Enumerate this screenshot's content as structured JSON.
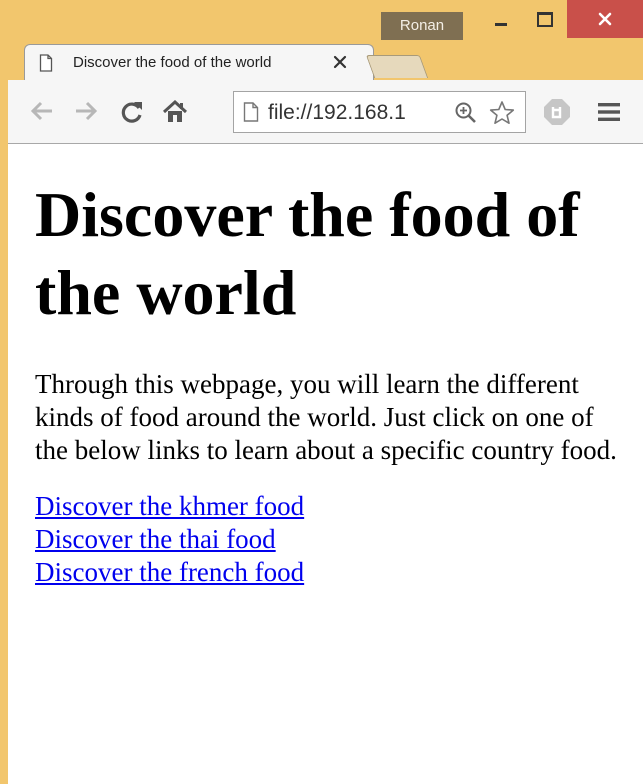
{
  "window": {
    "user_name": "Ronan",
    "close_color": "#c9504a",
    "frame_color": "#f2c66d"
  },
  "tab": {
    "title": "Discover the food of the world",
    "icon": "document-icon"
  },
  "toolbar": {
    "icons": [
      "back-arrow-icon",
      "forward-arrow-icon",
      "reload-icon",
      "home-icon",
      "zoom-icon",
      "star-icon",
      "adblock-icon",
      "menu-icon"
    ]
  },
  "address_bar": {
    "url": "file://192.168.1"
  },
  "page": {
    "heading": "Discover the food of the world",
    "intro": "Through this webpage, you will learn the different kinds of food around the world. Just click on one of the below links to learn about a specific country food.",
    "links": [
      "Discover the khmer food",
      "Discover the thai food",
      "Discover the french food"
    ],
    "link_color": "#0000ee"
  }
}
